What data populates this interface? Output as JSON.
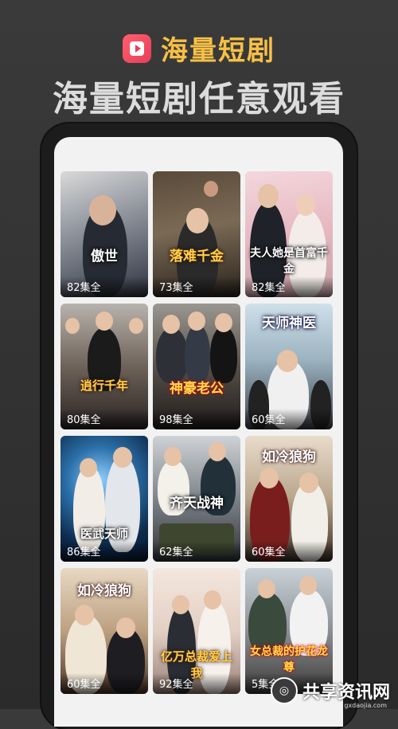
{
  "header": {
    "app_name": "海量短剧",
    "headline": "海量短剧任意观看"
  },
  "dramas": [
    {
      "title": "傲世",
      "episodes": "82集全"
    },
    {
      "title": "落难千金",
      "episodes": "73集全"
    },
    {
      "title": "夫人她是首富千金",
      "episodes": "82集全"
    },
    {
      "title": "逍行千年",
      "episodes": "80集全"
    },
    {
      "title": "神豪老公",
      "episodes": "98集全"
    },
    {
      "title": "天师神医",
      "episodes": "60集全"
    },
    {
      "title": "医武天师",
      "episodes": "86集全"
    },
    {
      "title": "齐天战神",
      "episodes": "62集全"
    },
    {
      "title": "如冷狼狗",
      "episodes": "60集全"
    },
    {
      "title": "如冷狼狗",
      "episodes": "60集全"
    },
    {
      "title": "亿万总裁爱上我",
      "episodes": "92集全"
    },
    {
      "title": "女总裁的护花龙尊",
      "episodes": "5集全"
    }
  ],
  "watermark": {
    "name": "共享资讯网",
    "url": "gxdaojia.com"
  }
}
